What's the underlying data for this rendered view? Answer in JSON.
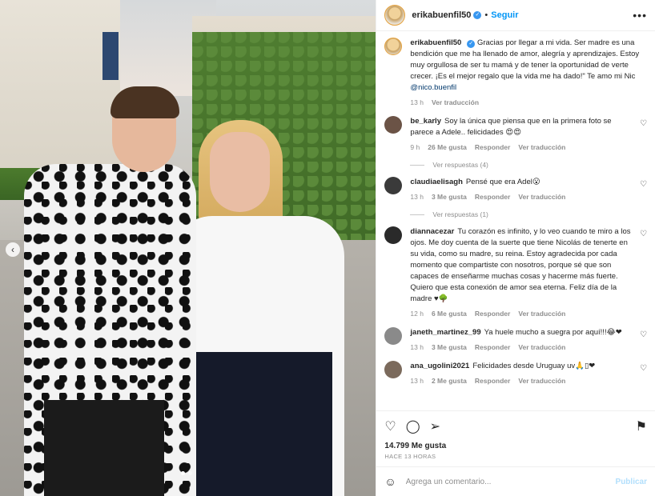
{
  "header": {
    "username": "erikabuenfil50",
    "separator": "•",
    "follow_label": "Seguir",
    "more_label": "•••"
  },
  "caption": {
    "username": "erikabuenfil50",
    "text": "Gracias por llegar a mi vida. Ser madre es una bendición que me ha llenado de amor, alegría y aprendizajes. Estoy muy orgullosa de ser tu mamá y de tener la oportunidad de verte crecer. ¡Es el mejor regalo que la vida me ha dado!\" Te amo mi Nic ",
    "mention": "@nico.buenfil",
    "time": "13 h",
    "translate": "Ver traducción"
  },
  "comments": [
    {
      "username": "be_karly",
      "text": "Soy la única que piensa que en la primera foto se parece a Adele.. felicidades 😍😍",
      "time": "9 h",
      "likes": "26 Me gusta",
      "reply": "Responder",
      "translate": "Ver traducción",
      "replies": "Ver respuestas (4)"
    },
    {
      "username": "claudiaelisagh",
      "text": "Pensé que era Adel😮",
      "time": "13 h",
      "likes": "3 Me gusta",
      "reply": "Responder",
      "translate": "Ver traducción",
      "replies": "Ver respuestas (1)"
    },
    {
      "username": "diannacezar",
      "text": "Tu corazón es infinito, y lo veo cuando te miro a los ojos. Me doy cuenta de la suerte que tiene Nicolás de tenerte en su vida, como su madre, su reina. Estoy agradecida por cada momento que compartiste con nosotros, porque sé que son capaces de enseñarme muchas cosas y hacerme más fuerte. Quiero que esta conexión de amor sea eterna. Feliz día de la madre ♥🌳",
      "time": "12 h",
      "likes": "6 Me gusta",
      "reply": "Responder",
      "translate": "Ver traducción"
    },
    {
      "username": "janeth_martinez_99",
      "text": "Ya huele mucho a suegra por aquí!!!😂❤",
      "time": "13 h",
      "likes": "3 Me gusta",
      "reply": "Responder",
      "translate": "Ver traducción"
    },
    {
      "username": "ana_ugolini2021",
      "text": "Felicidades desde Uruguay uv🙏▯❤",
      "time": "13 h",
      "likes": "2 Me gusta",
      "reply": "Responder",
      "translate": "Ver traducción"
    }
  ],
  "actions": {
    "like_icon": "♡",
    "comment_icon": "◯",
    "share_icon": "➢",
    "save_icon": "⚑"
  },
  "likes_count": "14.799 Me gusta",
  "timestamp": "HACE 13 HORAS",
  "add_comment": {
    "emoji_icon": "☺",
    "placeholder": "Agrega un comentario...",
    "post_label": "Publicar"
  },
  "photo": {
    "prev_icon": "‹"
  },
  "colors": {
    "accent": "#0095f6",
    "verified": "#3897f0",
    "muted": "#8e8e8e"
  }
}
